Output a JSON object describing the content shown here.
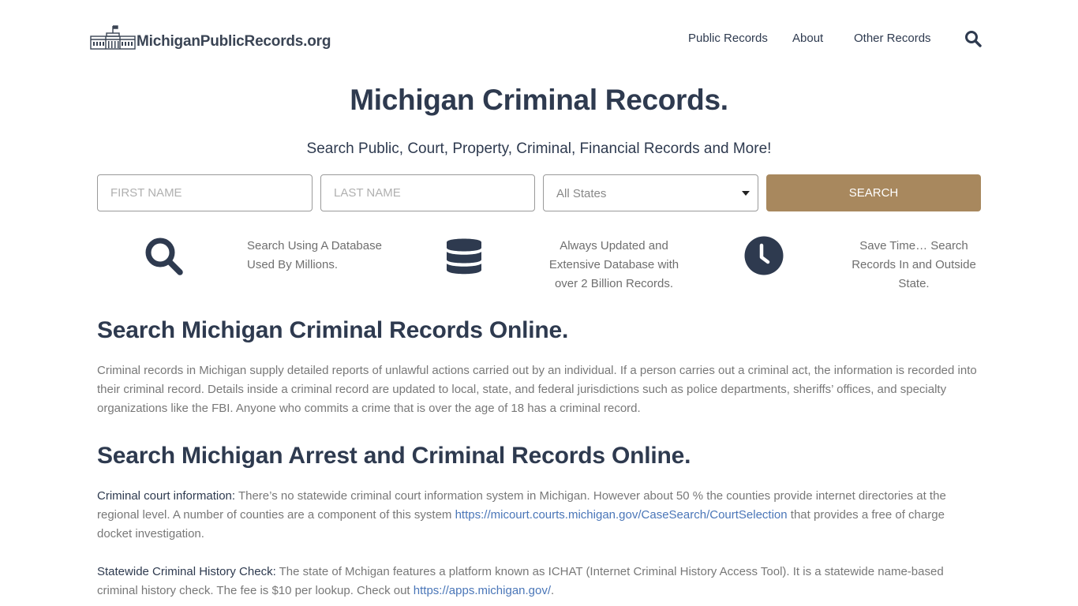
{
  "header": {
    "logo_text": "MichiganPublicRecords.org",
    "nav": [
      {
        "label": "Public Records"
      },
      {
        "label": "About"
      },
      {
        "label": "Other Records"
      }
    ],
    "search_icon": "search-icon"
  },
  "hero": {
    "title": "Michigan Criminal Records.",
    "subtitle": "Search Public, Court, Property, Criminal, Financial Records and More!"
  },
  "search_form": {
    "first_name_placeholder": "FIRST NAME",
    "first_name_value": "",
    "last_name_placeholder": "LAST NAME",
    "last_name_value": "",
    "state_selected": "All States",
    "button_label": "SEARCH",
    "button_color": "#a8885e"
  },
  "features": [
    {
      "icon": "search-icon",
      "text_lines": [
        "Search Using A Database",
        "Used By Millions."
      ]
    },
    {
      "icon": "database-icon",
      "text_lines": [
        "Always Updated and",
        "Extensive Database with",
        "over 2 Billion Records."
      ]
    },
    {
      "icon": "clock-icon",
      "text_lines": [
        "Save Time… Search",
        "Records In and Outside",
        "State."
      ]
    }
  ],
  "sections": [
    {
      "title": "Search Michigan Criminal Records Online.",
      "paragraph": "Criminal records in Michigan supply detailed reports of unlawful actions carried out by an individual. If a person carries out a criminal act, the information is recorded into their criminal record. Details inside a criminal record are updated to local, state, and federal jurisdictions such as police departments, sheriffs’ offices, and specialty organizations like the FBI. Anyone who commits a crime that is over the age of 18 has a criminal record."
    },
    {
      "title": "Search Michigan Arrest and Criminal Records Online.",
      "items": [
        {
          "label": "Criminal court information:",
          "text_before": " There’s no statewide criminal court information system in Michigan. However about 50 % the counties provide internet directories at the regional level. A number of counties are a component of this system ",
          "link": "https://micourt.courts.michigan.gov/CaseSearch/CourtSelection",
          "text_after": " that provides a free of charge docket investigation."
        },
        {
          "label": "Statewide Criminal History Check:",
          "text_before": " The state of Mchigan features a platform known as ICHAT (Internet Criminal History Access Tool). It is a statewide name-based criminal history check. The fee is $10 per lookup. Check out ",
          "link": "https://apps.michigan.gov/",
          "text_after": "."
        }
      ]
    }
  ],
  "colors": {
    "text_dark": "#2e3a4f",
    "body_text": "#787878",
    "link": "#4a76b8",
    "accent": "#a8885e"
  }
}
